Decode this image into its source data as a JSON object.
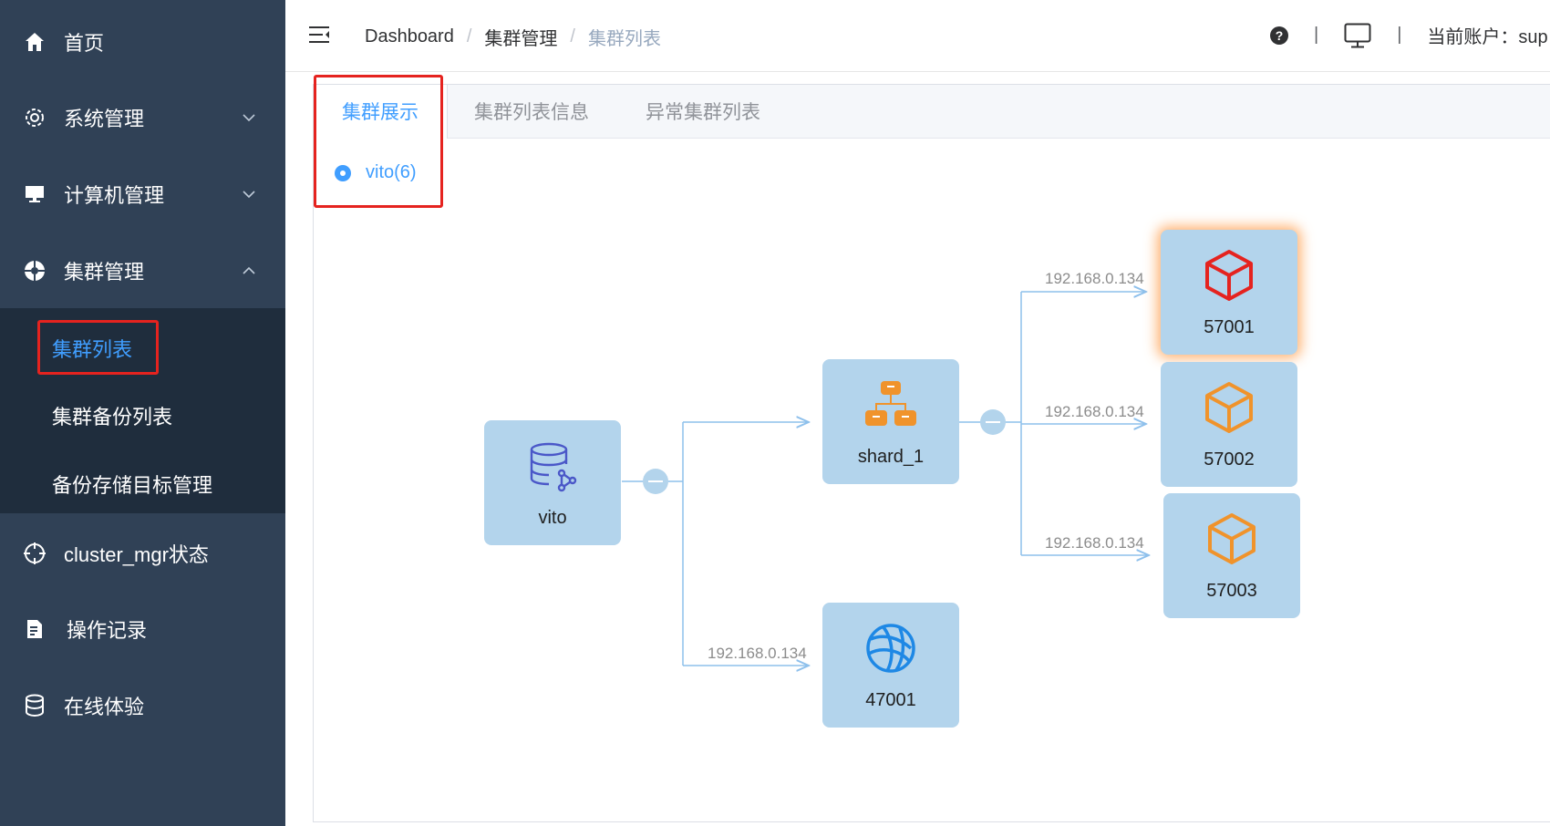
{
  "sidebar": {
    "items": [
      {
        "label": "首页",
        "icon": "home-icon"
      },
      {
        "label": "系统管理",
        "icon": "gear-icon"
      },
      {
        "label": "计算机管理",
        "icon": "monitor-icon"
      },
      {
        "label": "集群管理",
        "icon": "cluster-icon"
      },
      {
        "label": "cluster_mgr状态",
        "icon": "crosshair-icon"
      },
      {
        "label": "操作记录",
        "icon": "document-edit-icon"
      },
      {
        "label": "在线体验",
        "icon": "database-icon"
      }
    ],
    "submenu": [
      {
        "label": "集群列表",
        "active": true
      },
      {
        "label": "集群备份列表"
      },
      {
        "label": "备份存储目标管理"
      }
    ]
  },
  "header": {
    "breadcrumb": [
      "Dashboard",
      "集群管理",
      "集群列表"
    ],
    "separator": "/",
    "account_label": "当前账户：sup",
    "divider": "|"
  },
  "tabs": [
    {
      "label": "集群展示",
      "active": true
    },
    {
      "label": "集群列表信息"
    },
    {
      "label": "异常集群列表"
    }
  ],
  "cluster_radio": {
    "label": "vito(6)",
    "selected": true
  },
  "graph": {
    "nodes": {
      "root": {
        "label": "vito",
        "icon": "database-share-icon"
      },
      "shard": {
        "label": "shard_1",
        "icon": "org-chart-icon"
      },
      "n57001": {
        "label": "57001",
        "icon": "cube-icon",
        "status": "error"
      },
      "n57002": {
        "label": "57002",
        "icon": "cube-icon"
      },
      "n57003": {
        "label": "57003",
        "icon": "cube-icon"
      },
      "n47001": {
        "label": "47001",
        "icon": "globe-icon"
      }
    },
    "edges": {
      "e57001": "192.168.0.134",
      "e57002": "192.168.0.134",
      "e57003": "192.168.0.134",
      "e47001": "192.168.0.134"
    }
  },
  "colors": {
    "sidebar_bg": "#304156",
    "submenu_bg": "#1f2d3d",
    "accent": "#409eff",
    "node_bg": "#b3d4ec",
    "error": "#e5231f",
    "orange": "#f0932b"
  }
}
